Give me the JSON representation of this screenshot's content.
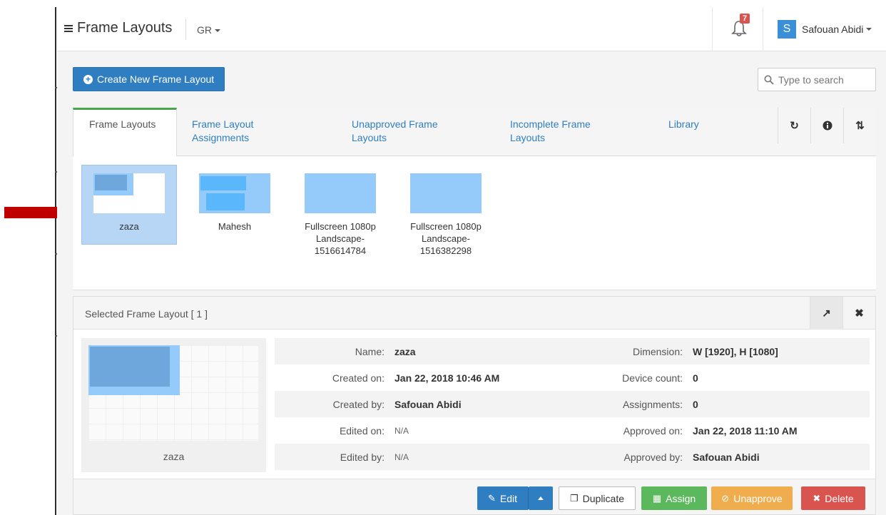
{
  "header": {
    "title": "Frame Layouts",
    "region": "GR",
    "notification_count": "7",
    "user_initial": "S",
    "user_name": "Safouan Abidi"
  },
  "toolbar": {
    "create_label": "Create New Frame Layout",
    "search_placeholder": "Type to search"
  },
  "tabs": [
    {
      "label": "Frame Layouts"
    },
    {
      "label": "Frame Layout Assignments"
    },
    {
      "label": "Unapproved Frame Layouts"
    },
    {
      "label": "Incomplete Frame Layouts"
    },
    {
      "label": "Library"
    }
  ],
  "layouts": [
    {
      "name": "zaza"
    },
    {
      "name": "Mahesh"
    },
    {
      "name": "Fullscreen 1080p Landscape- 1516614784"
    },
    {
      "name": "Fullscreen 1080p Landscape- 1516382298"
    }
  ],
  "details": {
    "title": "Selected Frame Layout [ 1 ]",
    "preview_name": "zaza",
    "rows": [
      {
        "label_l": "Name:",
        "value_l": "zaza",
        "label_r": "Dimension:",
        "value_r": "W [1920], H [1080]"
      },
      {
        "label_l": "Created on:",
        "value_l": "Jan 22, 2018 10:46 AM",
        "label_r": "Device count:",
        "value_r": "0"
      },
      {
        "label_l": "Created by:",
        "value_l": "Safouan Abidi",
        "label_r": "Assignments:",
        "value_r": "0"
      },
      {
        "label_l": "Edited on:",
        "value_l": "N/A",
        "label_r": "Approved on:",
        "value_r": "Jan 22, 2018 11:10 AM"
      },
      {
        "label_l": "Edited by:",
        "value_l": "N/A",
        "label_r": "Approved by:",
        "value_r": "Safouan Abidi"
      }
    ]
  },
  "actions": {
    "edit": "Edit",
    "duplicate": "Duplicate",
    "assign": "Assign",
    "unapprove": "Unapprove",
    "delete": "Delete"
  },
  "colors": {
    "primary": "#2f7ec1",
    "success": "#5cb85c",
    "warning": "#f0ad4e",
    "danger": "#d9534f",
    "active_tab": "#48a54b",
    "arrow": "#c00000"
  }
}
